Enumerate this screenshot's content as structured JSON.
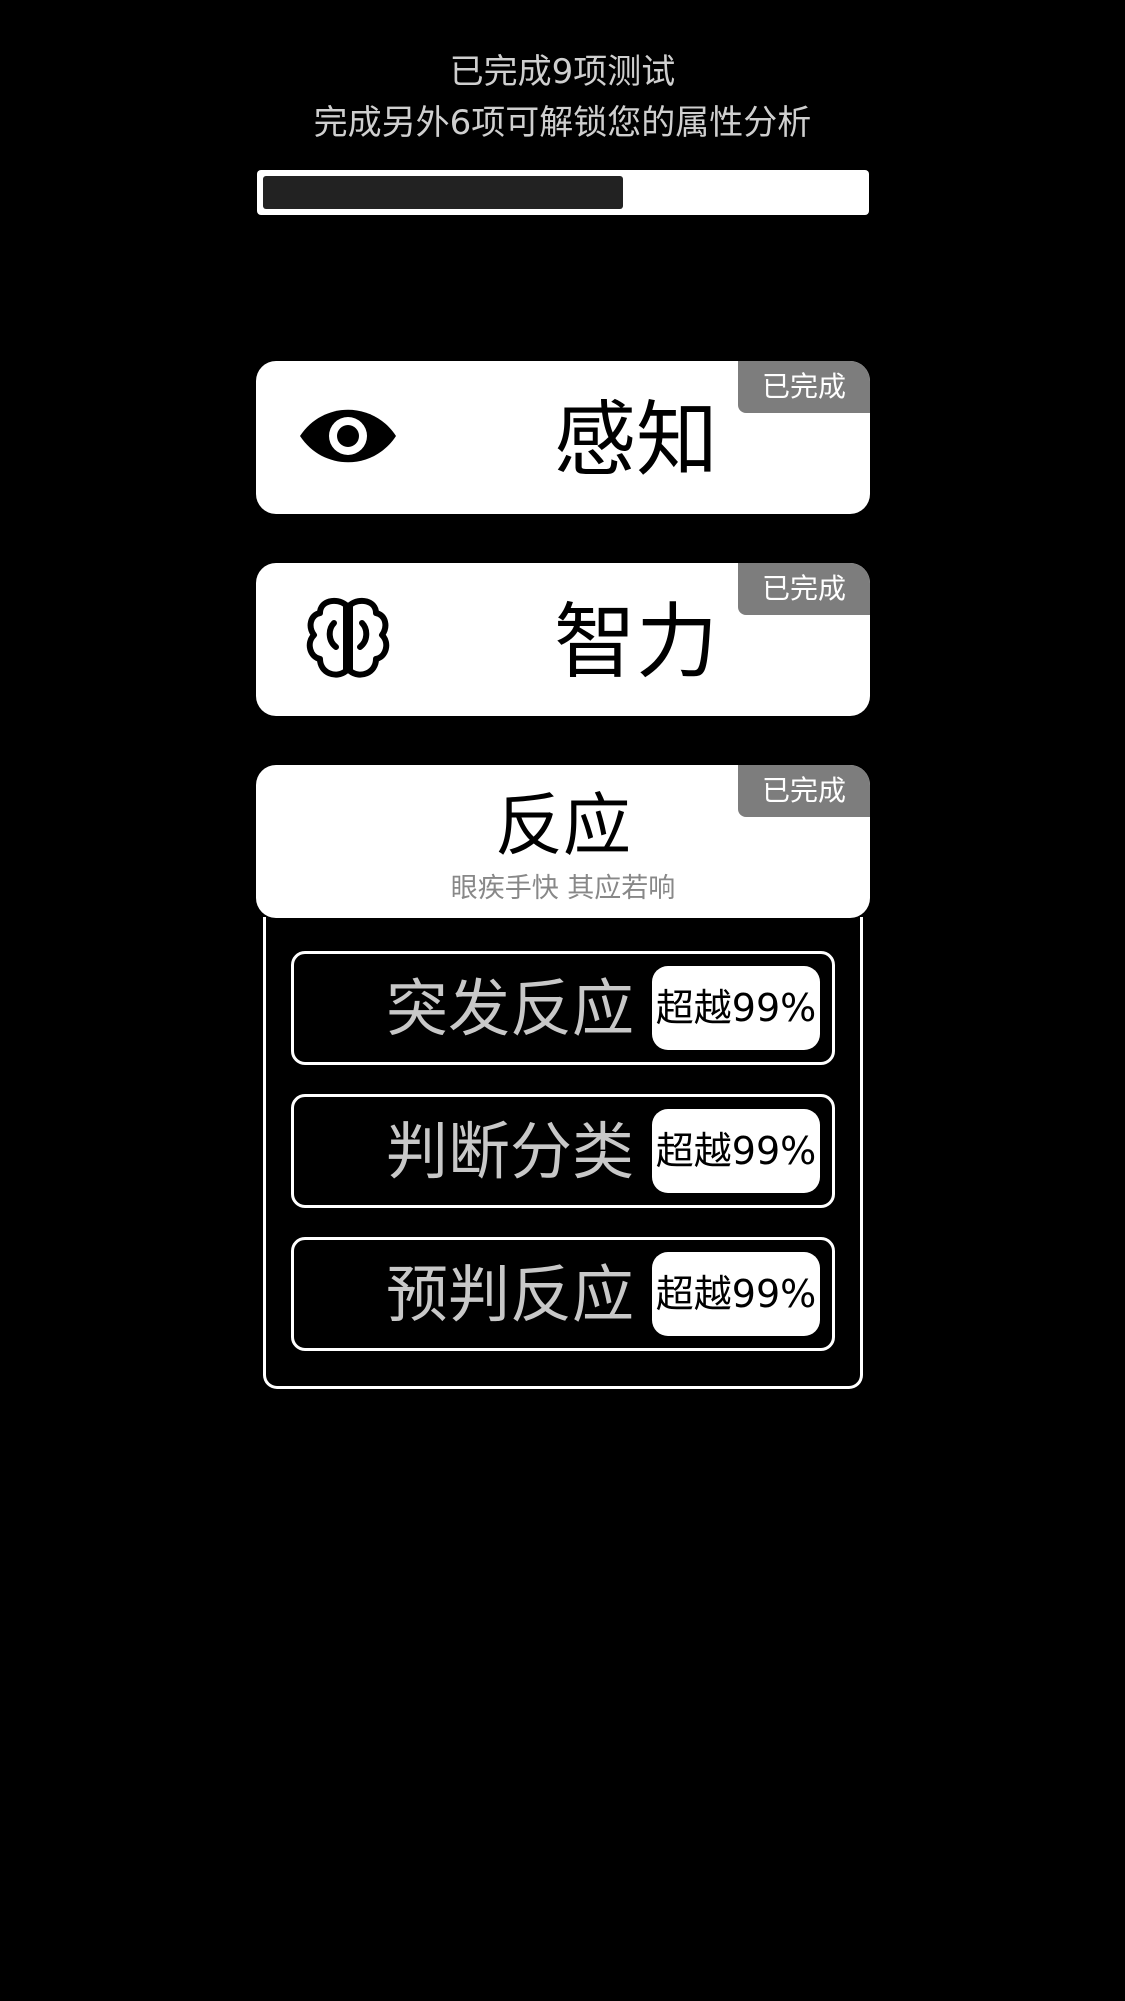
{
  "header": {
    "line1": "已完成9项测试",
    "line2": "完成另外6项可解锁您的属性分析"
  },
  "progress": {
    "completed": 9,
    "remaining": 6,
    "fill_fraction": 0.6
  },
  "categories": [
    {
      "title": "感知",
      "badge": "已完成",
      "icon": "eye-icon"
    },
    {
      "title": "智力",
      "badge": "已完成",
      "icon": "brain-icon"
    },
    {
      "title": "反应",
      "badge": "已完成",
      "subtitle": "眼疾手快 其应若响",
      "subtests": [
        {
          "label": "突发反应",
          "score": "超越99%"
        },
        {
          "label": "判断分类",
          "score": "超越99%"
        },
        {
          "label": "预判反应",
          "score": "超越99%"
        }
      ]
    }
  ],
  "colors": {
    "background": "#000000",
    "card": "#ffffff",
    "badge": "#7d7d7d",
    "progress_fill": "#222222"
  }
}
